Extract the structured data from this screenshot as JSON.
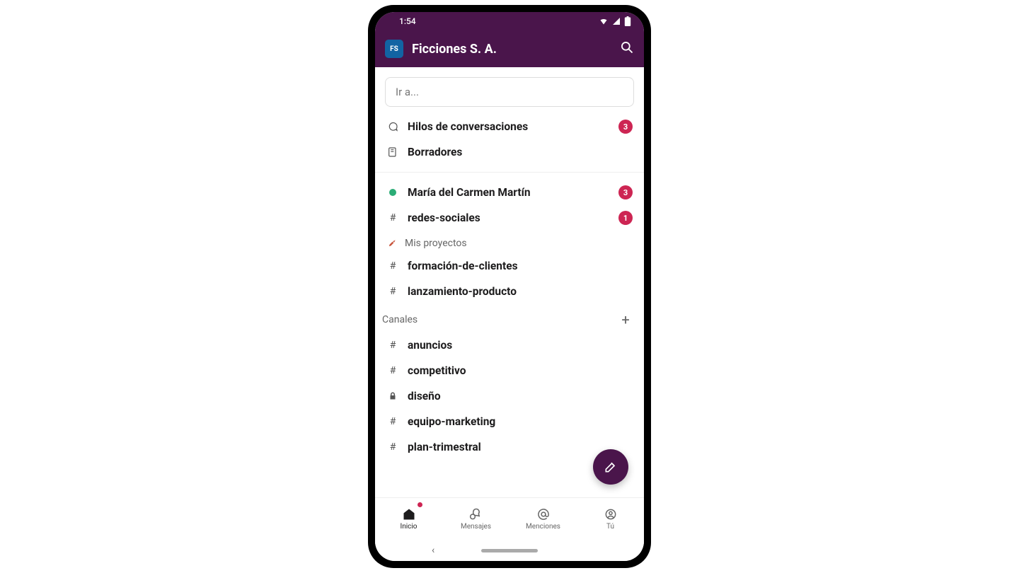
{
  "status": {
    "time": "1:54"
  },
  "header": {
    "ws_initials": "FS",
    "ws_name": "Ficciones S. A."
  },
  "jump": {
    "placeholder": "Ir a..."
  },
  "top_items": [
    {
      "icon": "threads",
      "label": "Hilos de conversaciones",
      "badge": "3"
    },
    {
      "icon": "drafts",
      "label": "Borradores",
      "badge": null
    }
  ],
  "unread": [
    {
      "icon": "presence",
      "label": "María del Carmen Martín",
      "badge": "3"
    },
    {
      "icon": "hash",
      "label": "redes-sociales",
      "badge": "1"
    }
  ],
  "projects": {
    "header": "Mis proyectos",
    "items": [
      {
        "icon": "hash",
        "label": "formación-de-clientes"
      },
      {
        "icon": "hash",
        "label": "lanzamiento-producto"
      }
    ]
  },
  "channels": {
    "header": "Canales",
    "items": [
      {
        "icon": "hash",
        "label": "anuncios"
      },
      {
        "icon": "hash",
        "label": "competitivo"
      },
      {
        "icon": "lock",
        "label": "diseño"
      },
      {
        "icon": "hash",
        "label": "equipo-marketing"
      },
      {
        "icon": "hash",
        "label": "plan-trimestral"
      }
    ]
  },
  "bottom_nav": [
    {
      "label": "Inicio",
      "icon": "home",
      "active": true,
      "dot": true
    },
    {
      "label": "Mensajes",
      "icon": "dms",
      "active": false,
      "dot": false
    },
    {
      "label": "Menciones",
      "icon": "mentions",
      "active": false,
      "dot": false
    },
    {
      "label": "Tú",
      "icon": "you",
      "active": false,
      "dot": false
    }
  ]
}
